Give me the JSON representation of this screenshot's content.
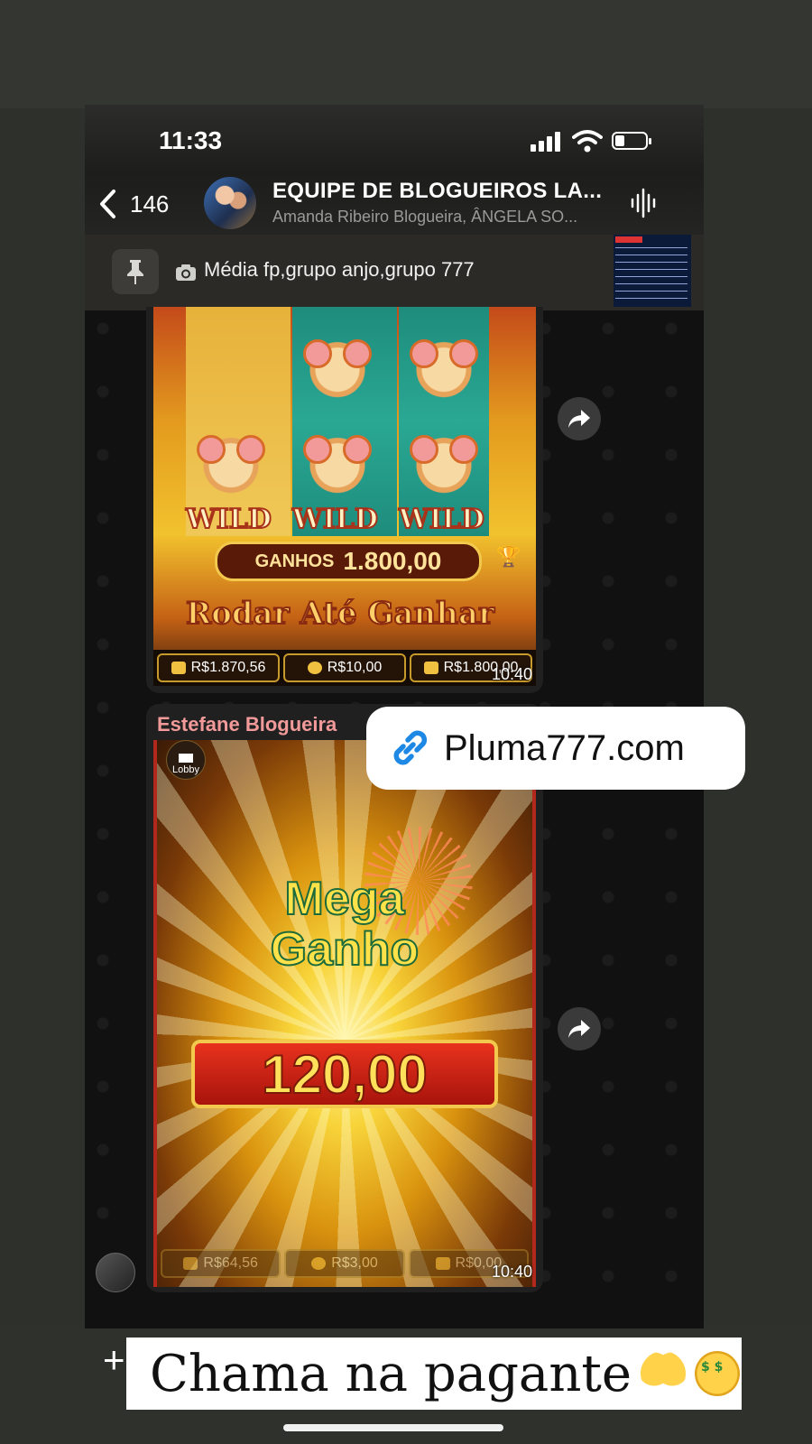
{
  "status_bar": {
    "time": "11:33"
  },
  "header": {
    "back_count": "146",
    "group_title": "EQUIPE DE BLOGUEIROS LA...",
    "group_subtitle": "Amanda Ribeiro Blogueira, ÂNGELA SO..."
  },
  "pinned": {
    "text": "Média fp,grupo anjo,grupo 777"
  },
  "messages": [
    {
      "game": {
        "wild_labels": [
          "WILD",
          "WILD",
          "WILD"
        ],
        "ganhos_label": "GANHOS",
        "ganhos_value": "1.800,00",
        "banner": "Rodar Até Ganhar",
        "balance": "R$1.870,56",
        "bet": "R$10,00",
        "win": "R$1.800,00"
      },
      "time": "10:40"
    },
    {
      "sender": "Estefane Blogueira",
      "game": {
        "lobby_label": "Lobby",
        "mega_line1": "Mega",
        "mega_line2": "Ganho",
        "win_amount": "120,00",
        "balance": "R$64,56",
        "bet": "R$3,00",
        "win": "R$0,00"
      },
      "time": "10:40"
    }
  ],
  "link_sticker": {
    "text": "Pluma777.com"
  },
  "caption": {
    "text": "Chama na pagante"
  },
  "colors": {
    "sender_name": "#f29a9a",
    "chat_bg": "#111111",
    "accent_link": "#1e88e5"
  }
}
